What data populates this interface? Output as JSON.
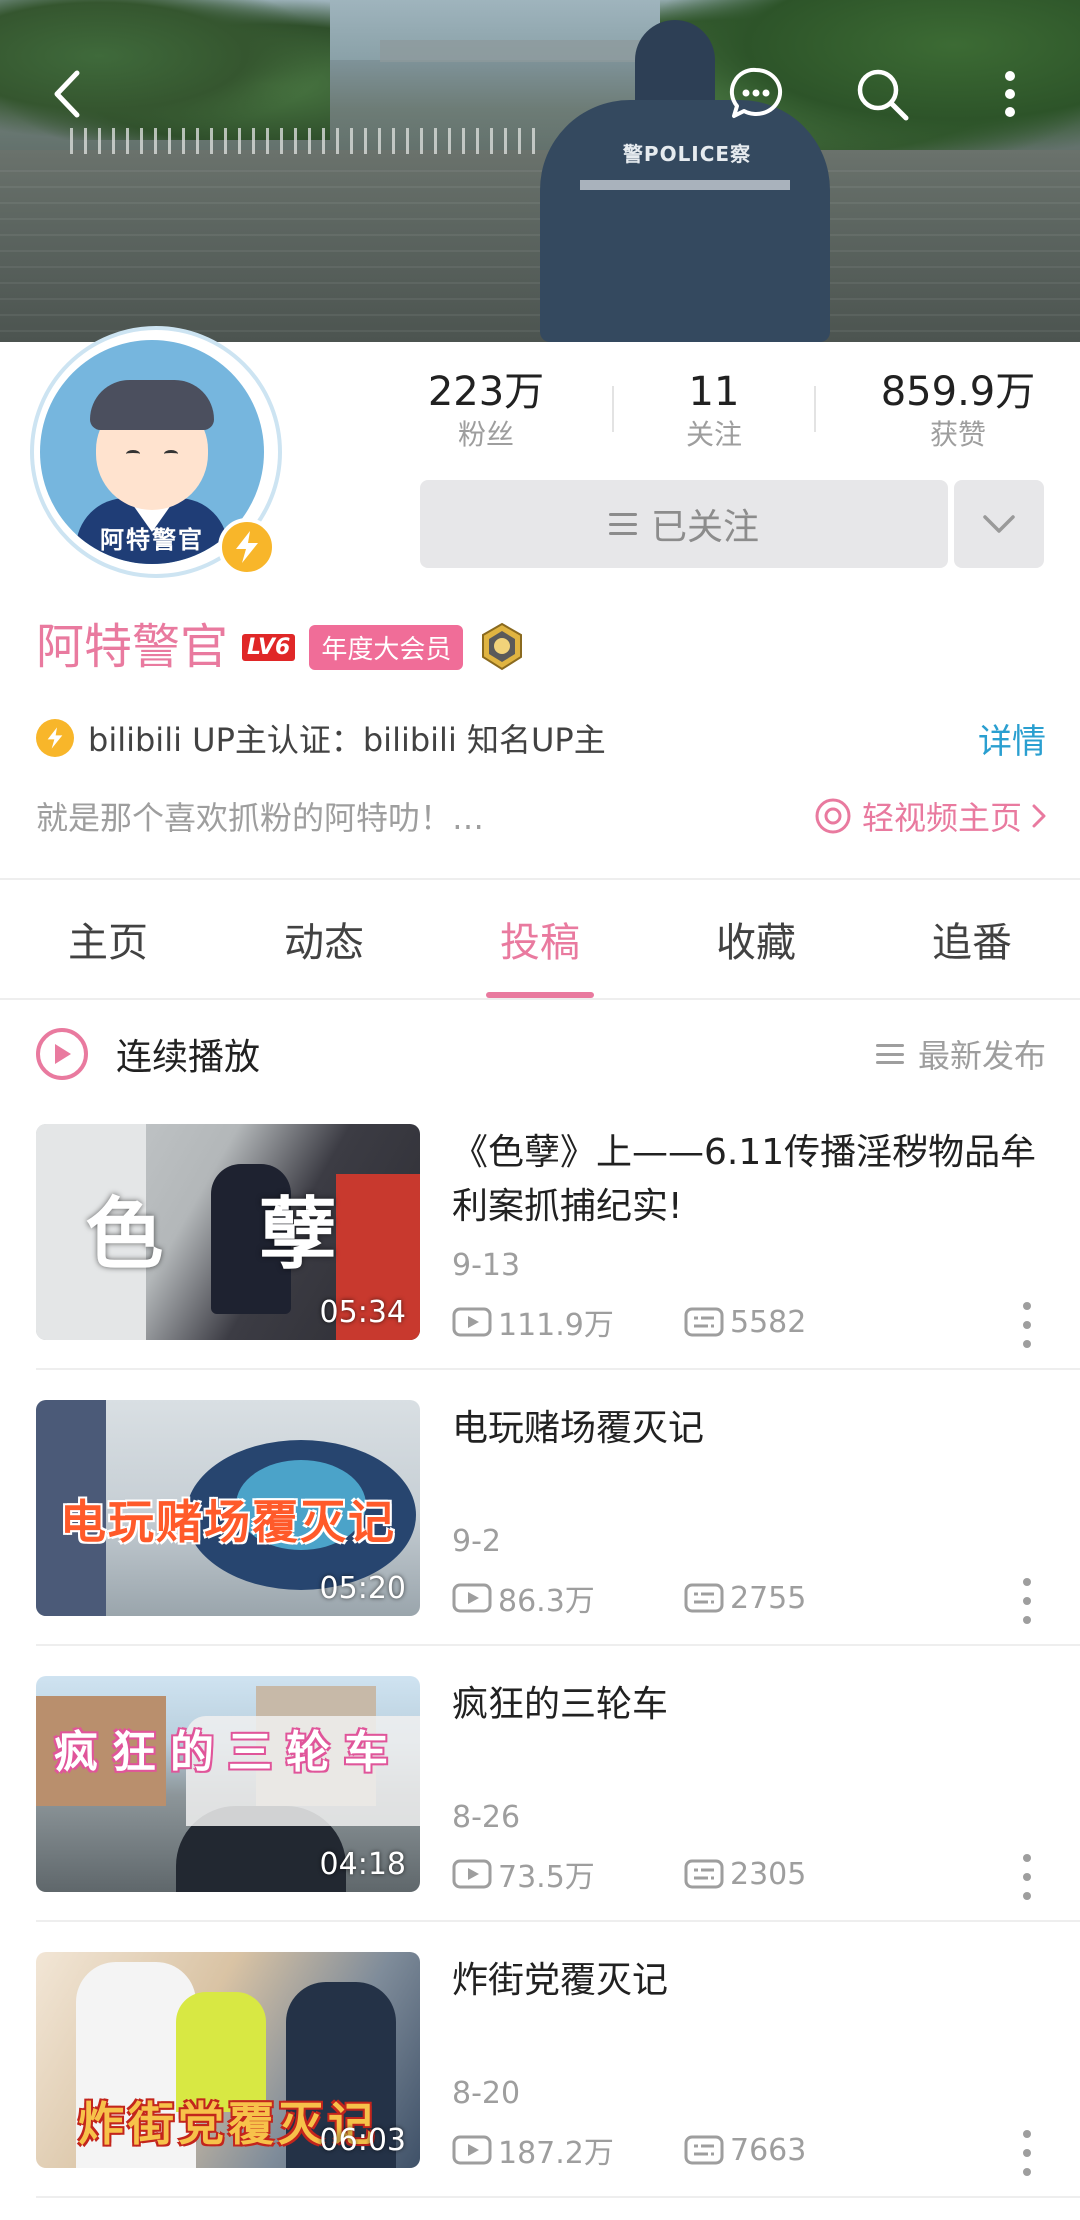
{
  "banner": {
    "police_text": "警POLICE察"
  },
  "avatar": {
    "caption": "阿特警官"
  },
  "stats": [
    {
      "value": "223万",
      "label": "粉丝"
    },
    {
      "value": "11",
      "label": "关注"
    },
    {
      "value": "859.9万",
      "label": "获赞"
    }
  ],
  "follow": {
    "label": "已关注"
  },
  "profile": {
    "name": "阿特警官",
    "level": "LV6",
    "vip_label": "年度大会员",
    "certification": "bilibili UP主认证：bilibili 知名UP主",
    "detail_link": "详情",
    "bio": "就是那个喜欢抓粉的阿特叻！…",
    "light_video_link": "轻视频主页"
  },
  "tabs": [
    "主页",
    "动态",
    "投稿",
    "收藏",
    "追番"
  ],
  "active_tab": "投稿",
  "play": {
    "label": "连续播放",
    "sort_label": "最新发布"
  },
  "videos": [
    {
      "title": "《色孽》上——6.11传播淫秽物品牟利案抓捕纪实!",
      "date": "9-13",
      "views": "111.9万",
      "comments": "5582",
      "duration": "05:34",
      "thumb_text": "色 孽"
    },
    {
      "title": "电玩赌场覆灭记",
      "date": "9-2",
      "views": "86.3万",
      "comments": "2755",
      "duration": "05:20",
      "thumb_text": "电玩赌场覆灭记"
    },
    {
      "title": "疯狂的三轮车",
      "date": "8-26",
      "views": "73.5万",
      "comments": "2305",
      "duration": "04:18",
      "thumb_text": "疯狂的三轮车"
    },
    {
      "title": "炸街党覆灭记",
      "date": "8-20",
      "views": "187.2万",
      "comments": "7663",
      "duration": "06:03",
      "thumb_text": "炸街党覆灭记"
    }
  ],
  "colors": {
    "accent": "#e97a9f",
    "link": "#2a9fd0",
    "gold": "#f8b62a",
    "muted": "#9e9e9e"
  }
}
